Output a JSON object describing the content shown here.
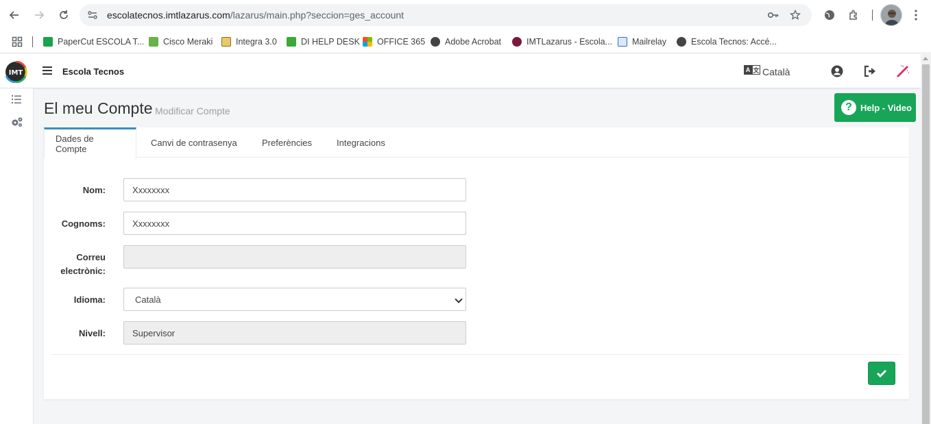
{
  "browser": {
    "url_host": "escolatecnos.imtlazarus.com",
    "url_path": "/lazarus/main.php?seccion=ges_account",
    "bookmarks": [
      {
        "label": "PaperCut ESCOLA T...",
        "icon": "papercut-icon",
        "color": "#1aa34a"
      },
      {
        "label": "Cisco Meraki",
        "icon": "meraki-icon",
        "color": "#67b346"
      },
      {
        "label": "Integra 3.0",
        "icon": "notepad-icon",
        "color": "#c9a227"
      },
      {
        "label": "DI HELP DESK",
        "icon": "helpdesk-icon",
        "color": "#3aa935"
      },
      {
        "label": "OFFICE 365",
        "icon": "microsoft-icon",
        "color": "#f25022"
      },
      {
        "label": "Adobe Acrobat",
        "icon": "globe-icon",
        "color": "#444444"
      },
      {
        "label": "IMTLazarus - Escola...",
        "icon": "imt-icon",
        "color": "#7a1a3a"
      },
      {
        "label": "Mailrelay",
        "icon": "mail-icon",
        "color": "#2c6fb5"
      },
      {
        "label": "Escola Tecnos: Accé...",
        "icon": "globe-icon",
        "color": "#444444"
      }
    ]
  },
  "app": {
    "brand": "Escola Tecnos",
    "language": "Català",
    "page_title": "El meu Compte",
    "page_subtitle": "Modificar Compte",
    "help_label": "Help - Video",
    "tabs": [
      {
        "label": "Dades de Compte",
        "active": true
      },
      {
        "label": "Canvi de contrasenya",
        "active": false
      },
      {
        "label": "Preferències",
        "active": false
      },
      {
        "label": "Integracions",
        "active": false
      }
    ],
    "form": {
      "nom_label": "Nom:",
      "nom_value": "Xxxxxxxx",
      "cognoms_label": "Cognoms:",
      "cognoms_value": "Xxxxxxxx",
      "correu_label_1": "Correu",
      "correu_label_2": "electrònic:",
      "correu_value": "",
      "idioma_label": "Idioma:",
      "idioma_value": "Català",
      "nivell_label": "Nivell:",
      "nivell_value": "Supervisor"
    },
    "colors": {
      "accent_green": "#18a558",
      "active_tab_border": "#3c8dbc",
      "logout_red": "#d6336c"
    }
  }
}
